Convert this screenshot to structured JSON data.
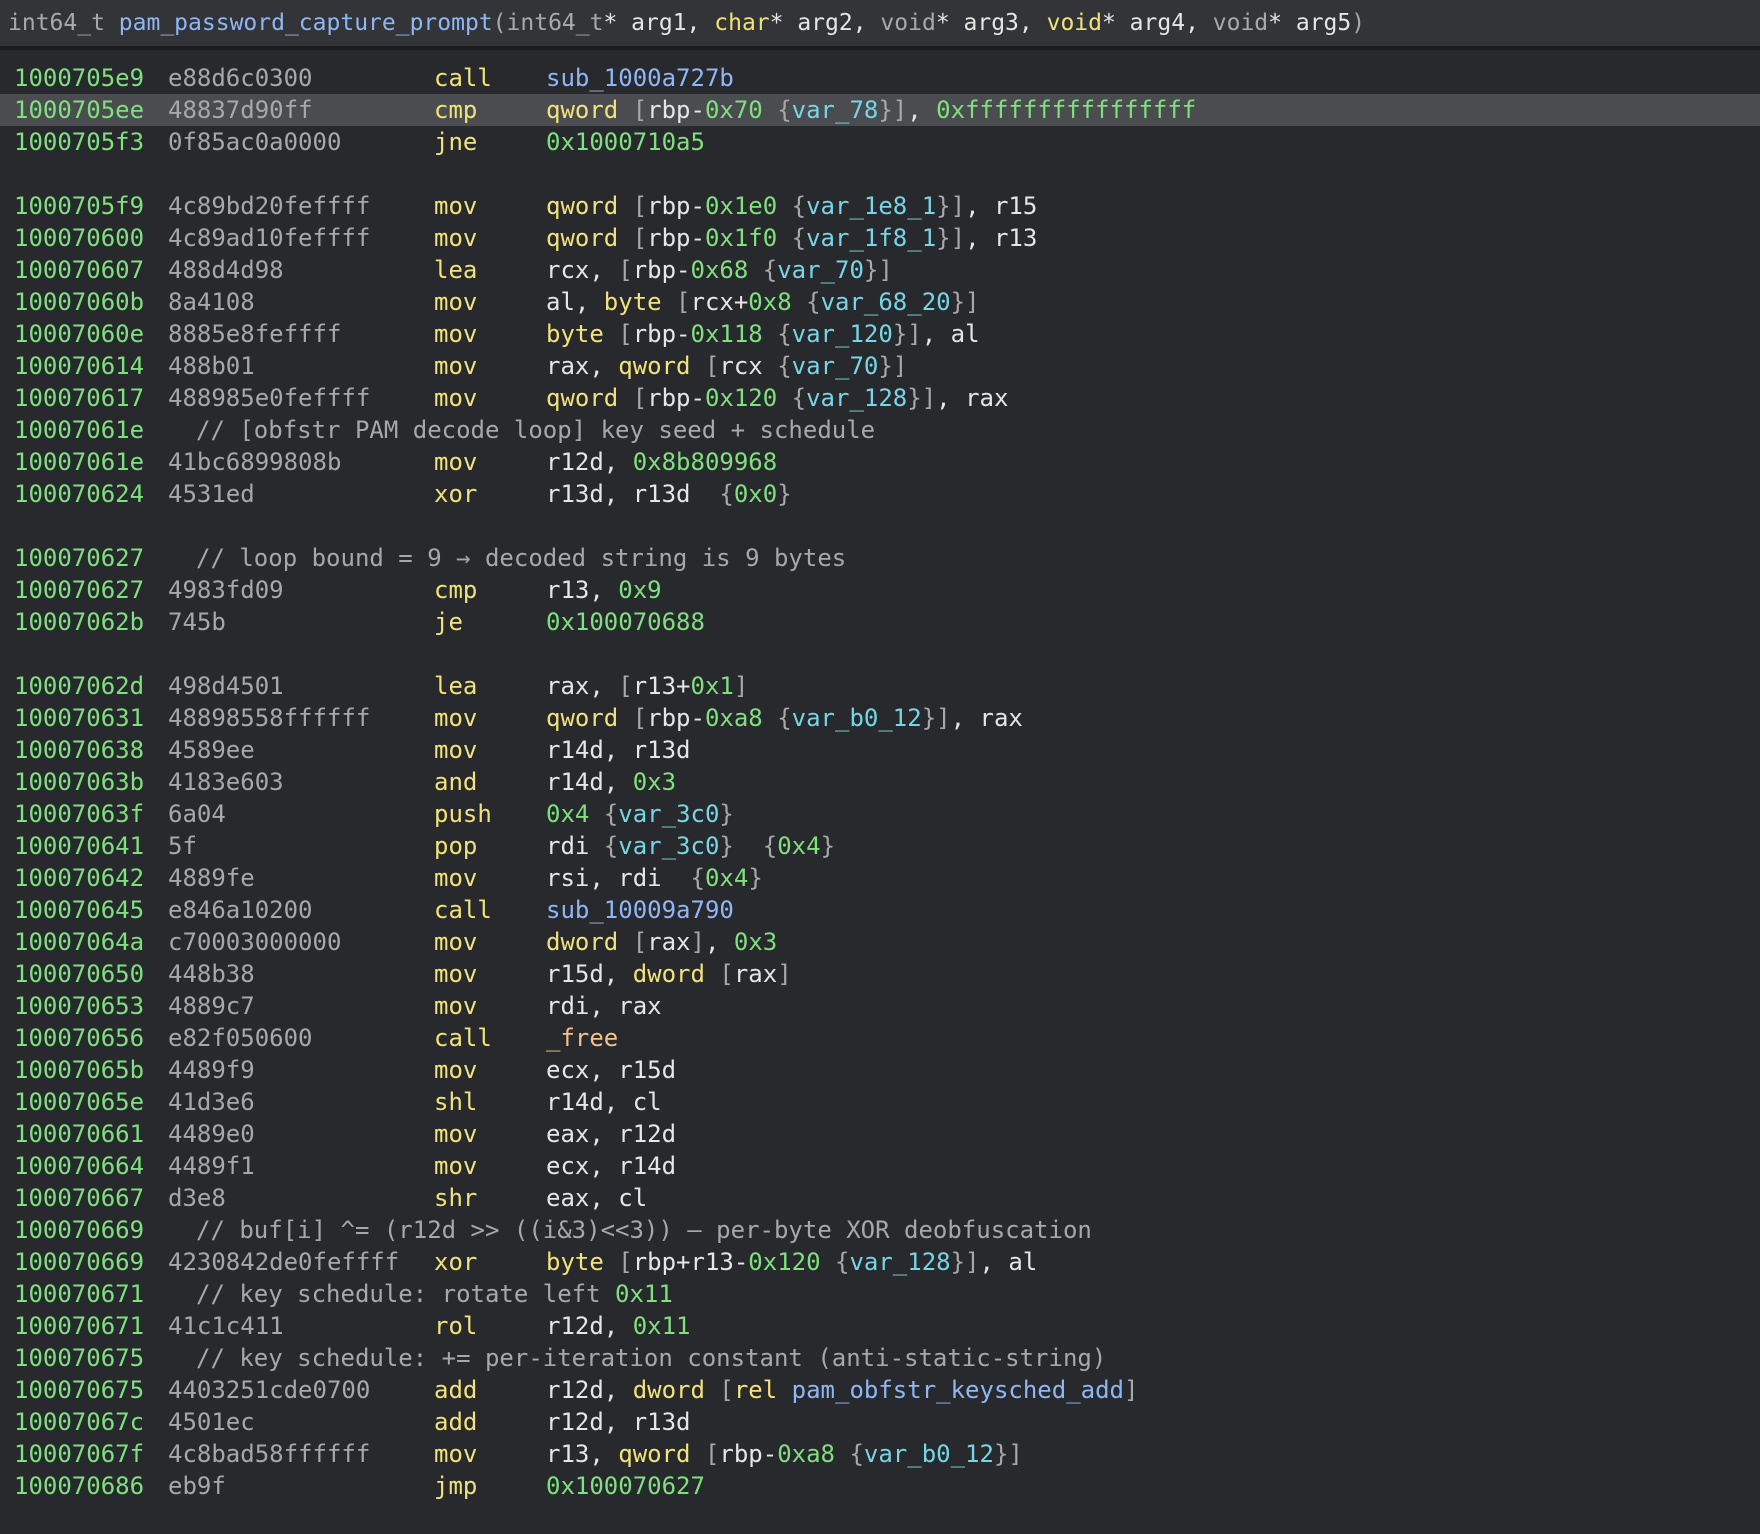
{
  "header": {
    "return_type": "int64_t",
    "func_name": "pam_password_capture_prompt",
    "params_segments": [
      {
        "t": "kw",
        "s": "("
      },
      {
        "t": "kw",
        "s": "int64_t"
      },
      {
        "t": "txt",
        "s": "* arg1, "
      },
      {
        "t": "ty",
        "s": "char"
      },
      {
        "t": "txt",
        "s": "* arg2, "
      },
      {
        "t": "kw",
        "s": "void"
      },
      {
        "t": "txt",
        "s": "* arg3, "
      },
      {
        "t": "ty",
        "s": "void"
      },
      {
        "t": "txt",
        "s": "* arg4, "
      },
      {
        "t": "kw",
        "s": "void"
      },
      {
        "t": "txt",
        "s": "* arg5"
      },
      {
        "t": "kw",
        "s": ")"
      }
    ]
  },
  "rows": [
    {
      "kind": "insn",
      "addr": "1000705e9",
      "bytes": "e88d6c0300",
      "mn": "call",
      "ops": [
        {
          "t": "sym",
          "s": "sub_1000a727b"
        }
      ]
    },
    {
      "kind": "insn",
      "hl": true,
      "addr": "1000705ee",
      "bytes": "48837d90ff",
      "mn": "cmp",
      "ops": [
        {
          "t": "typ",
          "s": "qword "
        },
        {
          "t": "brc",
          "s": "["
        },
        {
          "t": "txt",
          "s": "rbp-"
        },
        {
          "t": "num",
          "s": "0x70"
        },
        {
          "t": "brc",
          "s": " {"
        },
        {
          "t": "var",
          "s": "var_78"
        },
        {
          "t": "brc",
          "s": "}]"
        },
        {
          "t": "txt",
          "s": ", "
        },
        {
          "t": "num",
          "s": "0xffffffffffffffff"
        }
      ]
    },
    {
      "kind": "insn",
      "addr": "1000705f3",
      "bytes": "0f85ac0a0000",
      "mn": "jne",
      "ops": [
        {
          "t": "num",
          "s": "0x1000710a5"
        }
      ]
    },
    {
      "kind": "blank"
    },
    {
      "kind": "insn",
      "addr": "1000705f9",
      "bytes": "4c89bd20feffff",
      "mn": "mov",
      "ops": [
        {
          "t": "typ",
          "s": "qword "
        },
        {
          "t": "brc",
          "s": "["
        },
        {
          "t": "txt",
          "s": "rbp-"
        },
        {
          "t": "num",
          "s": "0x1e0"
        },
        {
          "t": "brc",
          "s": " {"
        },
        {
          "t": "var",
          "s": "var_1e8_1"
        },
        {
          "t": "brc",
          "s": "}]"
        },
        {
          "t": "txt",
          "s": ", r15"
        }
      ]
    },
    {
      "kind": "insn",
      "addr": "100070600",
      "bytes": "4c89ad10feffff",
      "mn": "mov",
      "ops": [
        {
          "t": "typ",
          "s": "qword "
        },
        {
          "t": "brc",
          "s": "["
        },
        {
          "t": "txt",
          "s": "rbp-"
        },
        {
          "t": "num",
          "s": "0x1f0"
        },
        {
          "t": "brc",
          "s": " {"
        },
        {
          "t": "var",
          "s": "var_1f8_1"
        },
        {
          "t": "brc",
          "s": "}]"
        },
        {
          "t": "txt",
          "s": ", r13"
        }
      ]
    },
    {
      "kind": "insn",
      "addr": "100070607",
      "bytes": "488d4d98",
      "mn": "lea",
      "ops": [
        {
          "t": "txt",
          "s": "rcx, "
        },
        {
          "t": "brc",
          "s": "["
        },
        {
          "t": "txt",
          "s": "rbp-"
        },
        {
          "t": "num",
          "s": "0x68"
        },
        {
          "t": "brc",
          "s": " {"
        },
        {
          "t": "var",
          "s": "var_70"
        },
        {
          "t": "brc",
          "s": "}]"
        }
      ]
    },
    {
      "kind": "insn",
      "addr": "10007060b",
      "bytes": "8a4108",
      "mn": "mov",
      "ops": [
        {
          "t": "txt",
          "s": "al, "
        },
        {
          "t": "typ",
          "s": "byte "
        },
        {
          "t": "brc",
          "s": "["
        },
        {
          "t": "txt",
          "s": "rcx+"
        },
        {
          "t": "num",
          "s": "0x8"
        },
        {
          "t": "brc",
          "s": " {"
        },
        {
          "t": "var",
          "s": "var_68_20"
        },
        {
          "t": "brc",
          "s": "}]"
        }
      ]
    },
    {
      "kind": "insn",
      "addr": "10007060e",
      "bytes": "8885e8feffff",
      "mn": "mov",
      "ops": [
        {
          "t": "typ",
          "s": "byte "
        },
        {
          "t": "brc",
          "s": "["
        },
        {
          "t": "txt",
          "s": "rbp-"
        },
        {
          "t": "num",
          "s": "0x118"
        },
        {
          "t": "brc",
          "s": " {"
        },
        {
          "t": "var",
          "s": "var_120"
        },
        {
          "t": "brc",
          "s": "}]"
        },
        {
          "t": "txt",
          "s": ", al"
        }
      ]
    },
    {
      "kind": "insn",
      "addr": "100070614",
      "bytes": "488b01",
      "mn": "mov",
      "ops": [
        {
          "t": "txt",
          "s": "rax, "
        },
        {
          "t": "typ",
          "s": "qword "
        },
        {
          "t": "brc",
          "s": "["
        },
        {
          "t": "txt",
          "s": "rcx"
        },
        {
          "t": "brc",
          "s": " {"
        },
        {
          "t": "var",
          "s": "var_70"
        },
        {
          "t": "brc",
          "s": "}]"
        }
      ]
    },
    {
      "kind": "insn",
      "addr": "100070617",
      "bytes": "488985e0feffff",
      "mn": "mov",
      "ops": [
        {
          "t": "typ",
          "s": "qword "
        },
        {
          "t": "brc",
          "s": "["
        },
        {
          "t": "txt",
          "s": "rbp-"
        },
        {
          "t": "num",
          "s": "0x120"
        },
        {
          "t": "brc",
          "s": " {"
        },
        {
          "t": "var",
          "s": "var_128"
        },
        {
          "t": "brc",
          "s": "}]"
        },
        {
          "t": "txt",
          "s": ", rax"
        }
      ]
    },
    {
      "kind": "comment",
      "addr": "10007061e",
      "text": "// [obfstr PAM decode loop] key seed + schedule"
    },
    {
      "kind": "insn",
      "addr": "10007061e",
      "bytes": "41bc6899808b",
      "mn": "mov",
      "ops": [
        {
          "t": "txt",
          "s": "r12d, "
        },
        {
          "t": "num",
          "s": "0x8b809968"
        }
      ]
    },
    {
      "kind": "insn",
      "addr": "100070624",
      "bytes": "4531ed",
      "mn": "xor",
      "ops": [
        {
          "t": "txt",
          "s": "r13d, r13d  "
        },
        {
          "t": "brc",
          "s": "{"
        },
        {
          "t": "num",
          "s": "0x0"
        },
        {
          "t": "brc",
          "s": "}"
        }
      ]
    },
    {
      "kind": "blank"
    },
    {
      "kind": "comment",
      "addr": "100070627",
      "text": "// loop bound = 9 → decoded string is 9 bytes"
    },
    {
      "kind": "insn",
      "addr": "100070627",
      "bytes": "4983fd09",
      "mn": "cmp",
      "ops": [
        {
          "t": "txt",
          "s": "r13, "
        },
        {
          "t": "num",
          "s": "0x9"
        }
      ]
    },
    {
      "kind": "insn",
      "addr": "10007062b",
      "bytes": "745b",
      "mn": "je",
      "ops": [
        {
          "t": "num",
          "s": "0x100070688"
        }
      ]
    },
    {
      "kind": "blank"
    },
    {
      "kind": "insn",
      "addr": "10007062d",
      "bytes": "498d4501",
      "mn": "lea",
      "ops": [
        {
          "t": "txt",
          "s": "rax, "
        },
        {
          "t": "brc",
          "s": "["
        },
        {
          "t": "txt",
          "s": "r13+"
        },
        {
          "t": "num",
          "s": "0x1"
        },
        {
          "t": "brc",
          "s": "]"
        }
      ]
    },
    {
      "kind": "insn",
      "addr": "100070631",
      "bytes": "48898558ffffff",
      "mn": "mov",
      "ops": [
        {
          "t": "typ",
          "s": "qword "
        },
        {
          "t": "brc",
          "s": "["
        },
        {
          "t": "txt",
          "s": "rbp-"
        },
        {
          "t": "num",
          "s": "0xa8"
        },
        {
          "t": "brc",
          "s": " {"
        },
        {
          "t": "var",
          "s": "var_b0_12"
        },
        {
          "t": "brc",
          "s": "}]"
        },
        {
          "t": "txt",
          "s": ", rax"
        }
      ]
    },
    {
      "kind": "insn",
      "addr": "100070638",
      "bytes": "4589ee",
      "mn": "mov",
      "ops": [
        {
          "t": "txt",
          "s": "r14d, r13d"
        }
      ]
    },
    {
      "kind": "insn",
      "addr": "10007063b",
      "bytes": "4183e603",
      "mn": "and",
      "ops": [
        {
          "t": "txt",
          "s": "r14d, "
        },
        {
          "t": "num",
          "s": "0x3"
        }
      ]
    },
    {
      "kind": "insn",
      "addr": "10007063f",
      "bytes": "6a04",
      "mn": "push",
      "ops": [
        {
          "t": "num",
          "s": "0x4"
        },
        {
          "t": "brc",
          "s": " {"
        },
        {
          "t": "var",
          "s": "var_3c0"
        },
        {
          "t": "brc",
          "s": "}"
        }
      ]
    },
    {
      "kind": "insn",
      "addr": "100070641",
      "bytes": "5f",
      "mn": "pop",
      "ops": [
        {
          "t": "txt",
          "s": "rdi "
        },
        {
          "t": "brc",
          "s": "{"
        },
        {
          "t": "var",
          "s": "var_3c0"
        },
        {
          "t": "brc",
          "s": "}  {"
        },
        {
          "t": "num",
          "s": "0x4"
        },
        {
          "t": "brc",
          "s": "}"
        }
      ]
    },
    {
      "kind": "insn",
      "addr": "100070642",
      "bytes": "4889fe",
      "mn": "mov",
      "ops": [
        {
          "t": "txt",
          "s": "rsi, rdi  "
        },
        {
          "t": "brc",
          "s": "{"
        },
        {
          "t": "num",
          "s": "0x4"
        },
        {
          "t": "brc",
          "s": "}"
        }
      ]
    },
    {
      "kind": "insn",
      "addr": "100070645",
      "bytes": "e846a10200",
      "mn": "call",
      "ops": [
        {
          "t": "sym",
          "s": "sub_10009a790"
        }
      ]
    },
    {
      "kind": "insn",
      "addr": "10007064a",
      "bytes": "c70003000000",
      "mn": "mov",
      "ops": [
        {
          "t": "typ",
          "s": "dword "
        },
        {
          "t": "brc",
          "s": "["
        },
        {
          "t": "txt",
          "s": "rax"
        },
        {
          "t": "brc",
          "s": "]"
        },
        {
          "t": "txt",
          "s": ", "
        },
        {
          "t": "num",
          "s": "0x3"
        }
      ]
    },
    {
      "kind": "insn",
      "addr": "100070650",
      "bytes": "448b38",
      "mn": "mov",
      "ops": [
        {
          "t": "txt",
          "s": "r15d, "
        },
        {
          "t": "typ",
          "s": "dword "
        },
        {
          "t": "brc",
          "s": "["
        },
        {
          "t": "txt",
          "s": "rax"
        },
        {
          "t": "brc",
          "s": "]"
        }
      ]
    },
    {
      "kind": "insn",
      "addr": "100070653",
      "bytes": "4889c7",
      "mn": "mov",
      "ops": [
        {
          "t": "txt",
          "s": "rdi, rax"
        }
      ]
    },
    {
      "kind": "insn",
      "addr": "100070656",
      "bytes": "e82f050600",
      "mn": "call",
      "ops": [
        {
          "t": "fnx",
          "s": "_free"
        }
      ]
    },
    {
      "kind": "insn",
      "addr": "10007065b",
      "bytes": "4489f9",
      "mn": "mov",
      "ops": [
        {
          "t": "txt",
          "s": "ecx, r15d"
        }
      ]
    },
    {
      "kind": "insn",
      "addr": "10007065e",
      "bytes": "41d3e6",
      "mn": "shl",
      "ops": [
        {
          "t": "txt",
          "s": "r14d, cl"
        }
      ]
    },
    {
      "kind": "insn",
      "addr": "100070661",
      "bytes": "4489e0",
      "mn": "mov",
      "ops": [
        {
          "t": "txt",
          "s": "eax, r12d"
        }
      ]
    },
    {
      "kind": "insn",
      "addr": "100070664",
      "bytes": "4489f1",
      "mn": "mov",
      "ops": [
        {
          "t": "txt",
          "s": "ecx, r14d"
        }
      ]
    },
    {
      "kind": "insn",
      "addr": "100070667",
      "bytes": "d3e8",
      "mn": "shr",
      "ops": [
        {
          "t": "txt",
          "s": "eax, cl"
        }
      ]
    },
    {
      "kind": "comment",
      "addr": "100070669",
      "text": "// buf[i] ^= (r12d >> ((i&3)<<3)) — per-byte XOR deobfuscation"
    },
    {
      "kind": "insn",
      "addr": "100070669",
      "bytes": "4230842de0feffff",
      "mn": "xor",
      "ops": [
        {
          "t": "typ",
          "s": "byte "
        },
        {
          "t": "brc",
          "s": "["
        },
        {
          "t": "txt",
          "s": "rbp+r13-"
        },
        {
          "t": "num",
          "s": "0x120"
        },
        {
          "t": "brc",
          "s": " {"
        },
        {
          "t": "var",
          "s": "var_128"
        },
        {
          "t": "brc",
          "s": "}]"
        },
        {
          "t": "txt",
          "s": ", al"
        }
      ]
    },
    {
      "kind": "comment",
      "addr": "100070671",
      "text": "// key schedule: rotate left ",
      "tail": "0x11"
    },
    {
      "kind": "insn",
      "addr": "100070671",
      "bytes": "41c1c411",
      "mn": "rol",
      "ops": [
        {
          "t": "txt",
          "s": "r12d, "
        },
        {
          "t": "num",
          "s": "0x11"
        }
      ]
    },
    {
      "kind": "comment",
      "addr": "100070675",
      "text": "// key schedule: += per-iteration constant (anti-static-string)"
    },
    {
      "kind": "insn",
      "addr": "100070675",
      "bytes": "4403251cde0700",
      "mn": "add",
      "ops": [
        {
          "t": "txt",
          "s": "r12d, "
        },
        {
          "t": "typ",
          "s": "dword "
        },
        {
          "t": "brc",
          "s": "["
        },
        {
          "t": "typ",
          "s": "rel "
        },
        {
          "t": "sym",
          "s": "pam_obfstr_keysched_add"
        },
        {
          "t": "brc",
          "s": "]"
        }
      ]
    },
    {
      "kind": "insn",
      "addr": "10007067c",
      "bytes": "4501ec",
      "mn": "add",
      "ops": [
        {
          "t": "txt",
          "s": "r12d, r13d"
        }
      ]
    },
    {
      "kind": "insn",
      "addr": "10007067f",
      "bytes": "4c8bad58ffffff",
      "mn": "mov",
      "ops": [
        {
          "t": "txt",
          "s": "r13, "
        },
        {
          "t": "typ",
          "s": "qword "
        },
        {
          "t": "brc",
          "s": "["
        },
        {
          "t": "txt",
          "s": "rbp-"
        },
        {
          "t": "num",
          "s": "0xa8"
        },
        {
          "t": "brc",
          "s": " {"
        },
        {
          "t": "var",
          "s": "var_b0_12"
        },
        {
          "t": "brc",
          "s": "}]"
        }
      ]
    },
    {
      "kind": "insn",
      "addr": "100070686",
      "bytes": "eb9f",
      "mn": "jmp",
      "ops": [
        {
          "t": "num",
          "s": "0x100070627"
        }
      ]
    }
  ]
}
